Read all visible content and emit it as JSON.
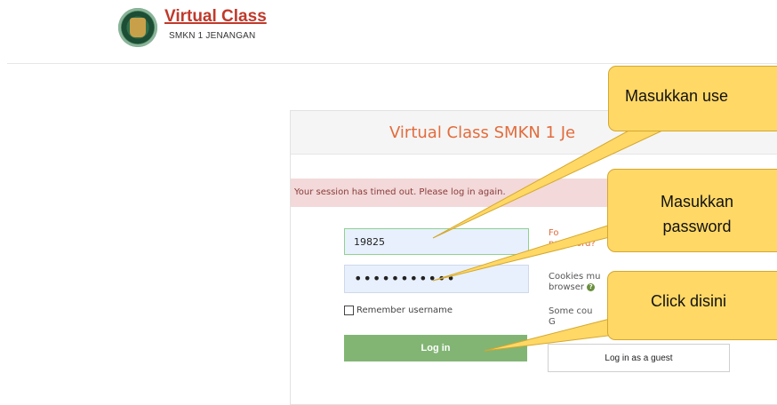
{
  "header": {
    "brand_title": "Virtual Class",
    "brand_subtitle": "SMKN 1 JENANGAN"
  },
  "login": {
    "title": "Virtual Class SMKN 1 Je",
    "alert": "Your session has timed out. Please log in again.",
    "username_value": "19825",
    "password_mask": "•••••••••••",
    "remember_label": "Remember username",
    "login_button": "Log in",
    "forgot_line1": "Fo",
    "forgot_line2": "password?",
    "cookies_line1": "Cookies mu",
    "cookies_line2": "browser",
    "some_line1": "Some cou",
    "some_line2": "G",
    "guest_button": "Log in as a guest"
  },
  "callouts": {
    "username": "Masukkan use",
    "password_line1": "Masukkan",
    "password_line2": "password",
    "click": "Click disini"
  },
  "colors": {
    "accent": "#e26c3c",
    "login_button": "#82b574",
    "alert_bg": "#f3d9d9",
    "callout_bg": "#ffd866"
  }
}
